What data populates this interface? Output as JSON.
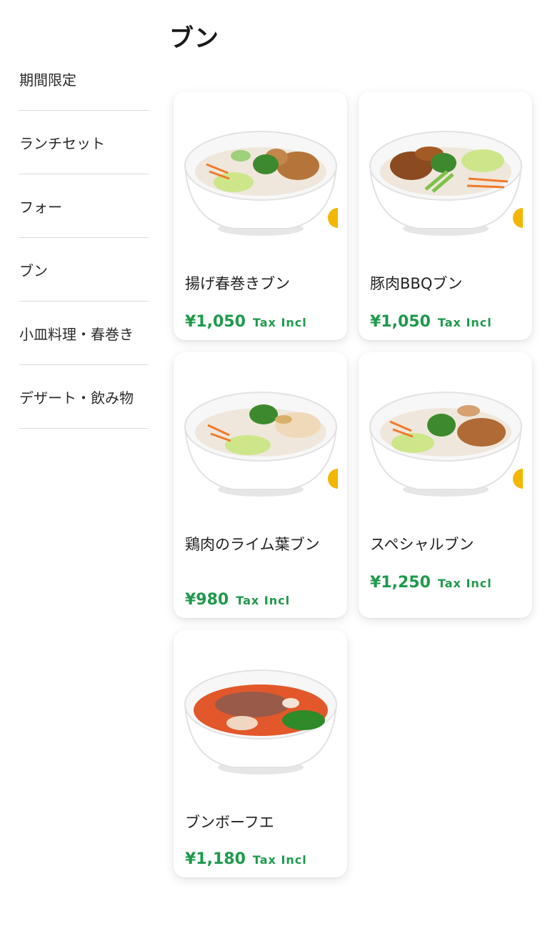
{
  "section_title": "ブン",
  "sidebar": {
    "items": [
      {
        "label": "期間限定"
      },
      {
        "label": "ランチセット"
      },
      {
        "label": "フォー"
      },
      {
        "label": "ブン"
      },
      {
        "label": "小皿料理・春巻き"
      },
      {
        "label": "デザート・飲み物"
      }
    ]
  },
  "menu": {
    "items": [
      {
        "name": "揚げ春巻きブン",
        "price": "¥1,050",
        "tax": "Tax Incl",
        "image": "bun-bowl-fried-spring-roll"
      },
      {
        "name": "豚肉BBQブン",
        "price": "¥1,050",
        "tax": "Tax Incl",
        "image": "bun-bowl-bbq-pork"
      },
      {
        "name": "鶏肉のライム葉ブン",
        "price": "¥980",
        "tax": "Tax Incl",
        "image": "bun-bowl-lime-leaf-chicken"
      },
      {
        "name": "スペシャルブン",
        "price": "¥1,250",
        "tax": "Tax Incl",
        "image": "bun-bowl-special"
      },
      {
        "name": "ブンボーフエ",
        "price": "¥1,180",
        "tax": "Tax Incl",
        "image": "bun-bo-hue-soup-bowl"
      }
    ]
  },
  "colors": {
    "price": "#1e9a4b",
    "divider": "#d9d9d9"
  }
}
